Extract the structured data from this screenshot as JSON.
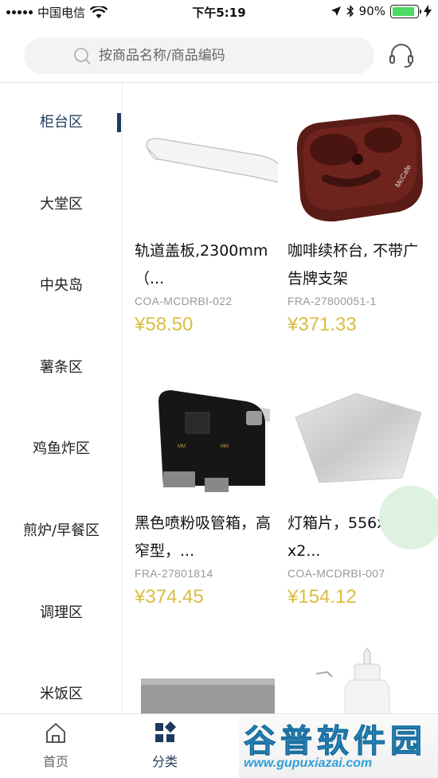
{
  "status_bar": {
    "carrier": "中国电信",
    "time": "下午5:19",
    "battery": "90%",
    "battery_level": 0.9
  },
  "search": {
    "placeholder": "按商品名称/商品编码",
    "icon": "search-icon"
  },
  "header": {
    "support_icon": "headset-icon"
  },
  "sidebar": {
    "items": [
      {
        "label": "柜台区",
        "active": true
      },
      {
        "label": "大堂区"
      },
      {
        "label": "中央岛"
      },
      {
        "label": "薯条区"
      },
      {
        "label": "鸡鱼炸区"
      },
      {
        "label": "煎炉/早餐区"
      },
      {
        "label": "调理区"
      },
      {
        "label": "米饭区"
      }
    ],
    "active_color": "#1f3b5c"
  },
  "products": [
    {
      "title": "轨道盖板,2300mm（...",
      "code": "COA-MCDRBI-022",
      "price": "¥58.50",
      "image": "white-strip"
    },
    {
      "title": "咖啡续杯台, 不带广告牌支架",
      "code": "FRA-27800051-1",
      "price": "¥371.33",
      "image": "brown-tray"
    },
    {
      "title": "黑色喷粉吸管箱，高窄型，...",
      "code": "FRA-27801814",
      "price": "¥374.45",
      "image": "black-box"
    },
    {
      "title": "灯箱片，556x558.5x2...",
      "code": "COA-MCDRBI-007",
      "price": "¥154.12",
      "image": "film-sheet"
    },
    {
      "title": "",
      "code": "",
      "price": "",
      "image": "steel-plate"
    },
    {
      "title": "",
      "code": "",
      "price": "",
      "image": "squeeze-bottle"
    }
  ],
  "price_color": "#d9bd3f",
  "tab_bar": {
    "tabs": [
      {
        "label": "首页",
        "icon": "home-icon"
      },
      {
        "label": "分类",
        "icon": "category-icon",
        "active": true
      }
    ]
  },
  "watermark": {
    "title": "谷普软件园",
    "url": "www.gupuxiazai.com"
  }
}
